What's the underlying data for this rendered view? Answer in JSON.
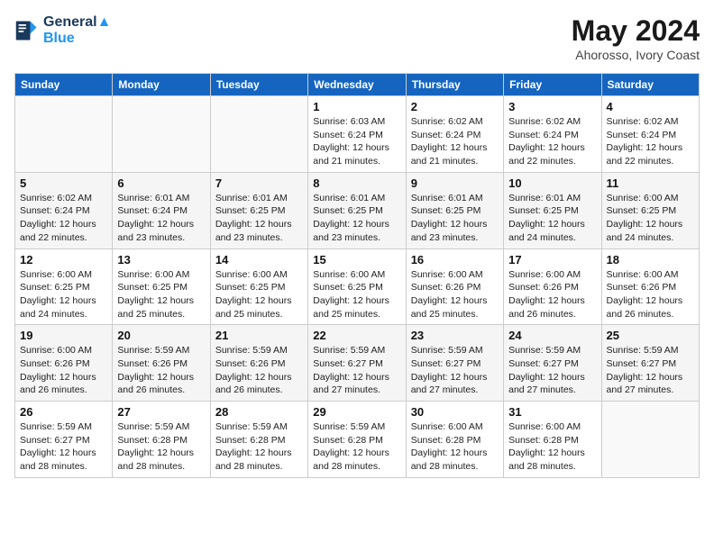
{
  "header": {
    "logo_line1": "General",
    "logo_line2": "Blue",
    "month_year": "May 2024",
    "location": "Ahorosso, Ivory Coast"
  },
  "weekdays": [
    "Sunday",
    "Monday",
    "Tuesday",
    "Wednesday",
    "Thursday",
    "Friday",
    "Saturday"
  ],
  "weeks": [
    [
      {
        "day": "",
        "info": ""
      },
      {
        "day": "",
        "info": ""
      },
      {
        "day": "",
        "info": ""
      },
      {
        "day": "1",
        "info": "Sunrise: 6:03 AM\nSunset: 6:24 PM\nDaylight: 12 hours\nand 21 minutes."
      },
      {
        "day": "2",
        "info": "Sunrise: 6:02 AM\nSunset: 6:24 PM\nDaylight: 12 hours\nand 21 minutes."
      },
      {
        "day": "3",
        "info": "Sunrise: 6:02 AM\nSunset: 6:24 PM\nDaylight: 12 hours\nand 22 minutes."
      },
      {
        "day": "4",
        "info": "Sunrise: 6:02 AM\nSunset: 6:24 PM\nDaylight: 12 hours\nand 22 minutes."
      }
    ],
    [
      {
        "day": "5",
        "info": "Sunrise: 6:02 AM\nSunset: 6:24 PM\nDaylight: 12 hours\nand 22 minutes."
      },
      {
        "day": "6",
        "info": "Sunrise: 6:01 AM\nSunset: 6:24 PM\nDaylight: 12 hours\nand 23 minutes."
      },
      {
        "day": "7",
        "info": "Sunrise: 6:01 AM\nSunset: 6:25 PM\nDaylight: 12 hours\nand 23 minutes."
      },
      {
        "day": "8",
        "info": "Sunrise: 6:01 AM\nSunset: 6:25 PM\nDaylight: 12 hours\nand 23 minutes."
      },
      {
        "day": "9",
        "info": "Sunrise: 6:01 AM\nSunset: 6:25 PM\nDaylight: 12 hours\nand 23 minutes."
      },
      {
        "day": "10",
        "info": "Sunrise: 6:01 AM\nSunset: 6:25 PM\nDaylight: 12 hours\nand 24 minutes."
      },
      {
        "day": "11",
        "info": "Sunrise: 6:00 AM\nSunset: 6:25 PM\nDaylight: 12 hours\nand 24 minutes."
      }
    ],
    [
      {
        "day": "12",
        "info": "Sunrise: 6:00 AM\nSunset: 6:25 PM\nDaylight: 12 hours\nand 24 minutes."
      },
      {
        "day": "13",
        "info": "Sunrise: 6:00 AM\nSunset: 6:25 PM\nDaylight: 12 hours\nand 25 minutes."
      },
      {
        "day": "14",
        "info": "Sunrise: 6:00 AM\nSunset: 6:25 PM\nDaylight: 12 hours\nand 25 minutes."
      },
      {
        "day": "15",
        "info": "Sunrise: 6:00 AM\nSunset: 6:25 PM\nDaylight: 12 hours\nand 25 minutes."
      },
      {
        "day": "16",
        "info": "Sunrise: 6:00 AM\nSunset: 6:26 PM\nDaylight: 12 hours\nand 25 minutes."
      },
      {
        "day": "17",
        "info": "Sunrise: 6:00 AM\nSunset: 6:26 PM\nDaylight: 12 hours\nand 26 minutes."
      },
      {
        "day": "18",
        "info": "Sunrise: 6:00 AM\nSunset: 6:26 PM\nDaylight: 12 hours\nand 26 minutes."
      }
    ],
    [
      {
        "day": "19",
        "info": "Sunrise: 6:00 AM\nSunset: 6:26 PM\nDaylight: 12 hours\nand 26 minutes."
      },
      {
        "day": "20",
        "info": "Sunrise: 5:59 AM\nSunset: 6:26 PM\nDaylight: 12 hours\nand 26 minutes."
      },
      {
        "day": "21",
        "info": "Sunrise: 5:59 AM\nSunset: 6:26 PM\nDaylight: 12 hours\nand 26 minutes."
      },
      {
        "day": "22",
        "info": "Sunrise: 5:59 AM\nSunset: 6:27 PM\nDaylight: 12 hours\nand 27 minutes."
      },
      {
        "day": "23",
        "info": "Sunrise: 5:59 AM\nSunset: 6:27 PM\nDaylight: 12 hours\nand 27 minutes."
      },
      {
        "day": "24",
        "info": "Sunrise: 5:59 AM\nSunset: 6:27 PM\nDaylight: 12 hours\nand 27 minutes."
      },
      {
        "day": "25",
        "info": "Sunrise: 5:59 AM\nSunset: 6:27 PM\nDaylight: 12 hours\nand 27 minutes."
      }
    ],
    [
      {
        "day": "26",
        "info": "Sunrise: 5:59 AM\nSunset: 6:27 PM\nDaylight: 12 hours\nand 28 minutes."
      },
      {
        "day": "27",
        "info": "Sunrise: 5:59 AM\nSunset: 6:28 PM\nDaylight: 12 hours\nand 28 minutes."
      },
      {
        "day": "28",
        "info": "Sunrise: 5:59 AM\nSunset: 6:28 PM\nDaylight: 12 hours\nand 28 minutes."
      },
      {
        "day": "29",
        "info": "Sunrise: 5:59 AM\nSunset: 6:28 PM\nDaylight: 12 hours\nand 28 minutes."
      },
      {
        "day": "30",
        "info": "Sunrise: 6:00 AM\nSunset: 6:28 PM\nDaylight: 12 hours\nand 28 minutes."
      },
      {
        "day": "31",
        "info": "Sunrise: 6:00 AM\nSunset: 6:28 PM\nDaylight: 12 hours\nand 28 minutes."
      },
      {
        "day": "",
        "info": ""
      }
    ]
  ]
}
